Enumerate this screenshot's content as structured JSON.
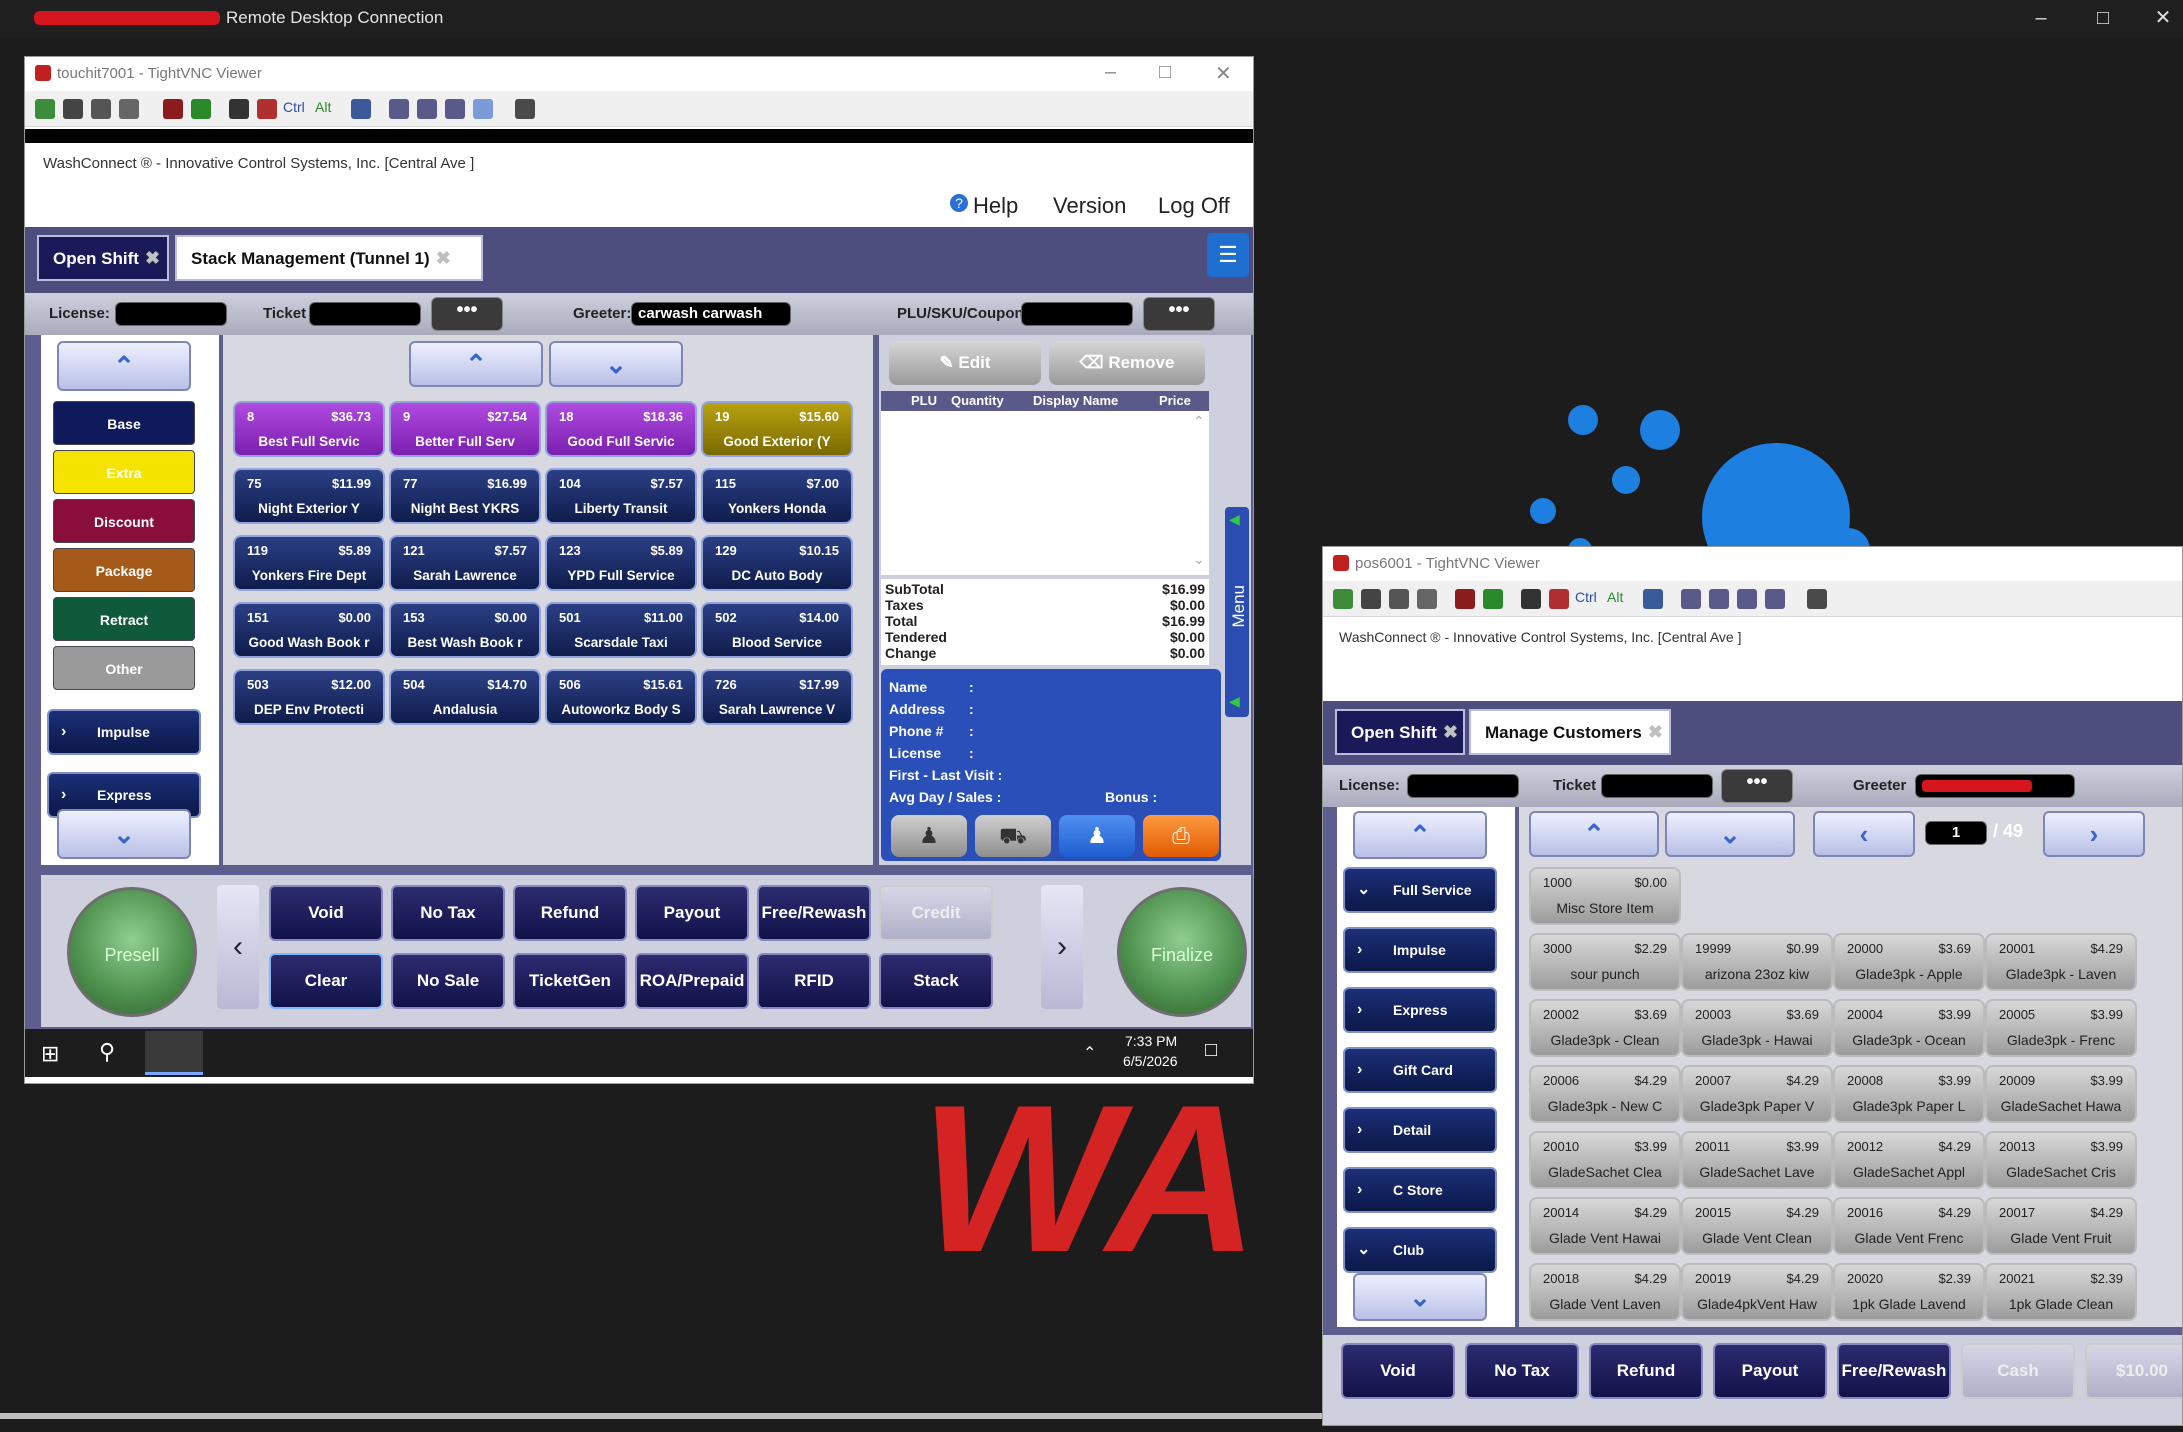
{
  "rdp": {
    "title": "Remote Desktop Connection"
  },
  "desktop": {
    "brand_text": "WA"
  },
  "vnc1": {
    "window_title": "touchit7001 - TightVNC Viewer",
    "app_title": "WashConnect ® - Innovative Control Systems, Inc. [Central Ave ]",
    "help": "Help",
    "version": "Version",
    "logoff": "Log Off",
    "tabs": [
      "Open Shift",
      "Stack Management (Tunnel 1)"
    ],
    "license_label": "License:",
    "ticket_label": "Ticket",
    "greeter_label": "Greeter:",
    "greeter_value": "carwash carwash",
    "plu_label": "PLU/SKU/Coupon",
    "categories": [
      "Base",
      "Extra",
      "Discount",
      "Package",
      "Retract",
      "Other",
      "Impulse",
      "Express"
    ],
    "products": [
      {
        "code": "8",
        "price": "$36.73",
        "name": "Best Full Servic",
        "color": "purple"
      },
      {
        "code": "9",
        "price": "$27.54",
        "name": "Better Full Serv",
        "color": "purple"
      },
      {
        "code": "18",
        "price": "$18.36",
        "name": "Good Full Servic",
        "color": "purple"
      },
      {
        "code": "19",
        "price": "$15.60",
        "name": "Good Exterior (Y",
        "color": "olive"
      },
      {
        "code": "75",
        "price": "$11.99",
        "name": "Night Exterior Y",
        "color": "blue"
      },
      {
        "code": "77",
        "price": "$16.99",
        "name": "Night Best YKRS",
        "color": "blue"
      },
      {
        "code": "104",
        "price": "$7.57",
        "name": "Liberty Transit",
        "color": "blue"
      },
      {
        "code": "115",
        "price": "$7.00",
        "name": "Yonkers Honda",
        "color": "blue"
      },
      {
        "code": "119",
        "price": "$5.89",
        "name": "Yonkers Fire Dept",
        "color": "blue"
      },
      {
        "code": "121",
        "price": "$7.57",
        "name": "Sarah Lawrence",
        "color": "blue"
      },
      {
        "code": "123",
        "price": "$5.89",
        "name": "YPD Full Service",
        "color": "blue"
      },
      {
        "code": "129",
        "price": "$10.15",
        "name": "DC Auto Body",
        "color": "blue"
      },
      {
        "code": "151",
        "price": "$0.00",
        "name": "Good Wash Book r",
        "color": "blue"
      },
      {
        "code": "153",
        "price": "$0.00",
        "name": "Best Wash Book r",
        "color": "blue"
      },
      {
        "code": "501",
        "price": "$11.00",
        "name": "Scarsdale Taxi",
        "color": "blue"
      },
      {
        "code": "502",
        "price": "$14.00",
        "name": "Blood Service",
        "color": "blue"
      },
      {
        "code": "503",
        "price": "$12.00",
        "name": "DEP Env Protecti",
        "color": "blue"
      },
      {
        "code": "504",
        "price": "$14.70",
        "name": "Andalusia",
        "color": "blue"
      },
      {
        "code": "506",
        "price": "$15.61",
        "name": "Autoworkz Body S",
        "color": "blue"
      },
      {
        "code": "726",
        "price": "$17.99",
        "name": "Sarah Lawrence V",
        "color": "blue"
      }
    ],
    "edit": "Edit",
    "remove": "Remove",
    "grid_headers": [
      "PLU",
      "Quantity",
      "Display Name",
      "Price"
    ],
    "totals": [
      {
        "label": "SubTotal",
        "value": "$16.99"
      },
      {
        "label": "Taxes",
        "value": "$0.00"
      },
      {
        "label": "Total",
        "value": "$16.99"
      },
      {
        "label": "Tendered",
        "value": "$0.00"
      },
      {
        "label": "Change",
        "value": "$0.00"
      }
    ],
    "customer": {
      "name": "Name",
      "address": "Address",
      "phone": "Phone #",
      "license": "License",
      "visit": "First - Last Visit :",
      "avg": "Avg Day / Sales :",
      "bonus": "Bonus :"
    },
    "menu_label": "Menu",
    "presell": "Presell",
    "finalize": "Finalize",
    "actions_top": [
      "Void",
      "No Tax",
      "Refund",
      "Payout",
      "Free/Rewash",
      "Credit"
    ],
    "actions_bottom": [
      "Clear",
      "No Sale",
      "TicketGen",
      "ROA/Prepaid",
      "RFID",
      "Stack"
    ],
    "clock_time": "7:33 PM",
    "clock_date": "6/5/2026"
  },
  "vnc2": {
    "window_title": "pos6001 - TightVNC Viewer",
    "app_title": "WashConnect ® - Innovative Control Systems, Inc. [Central Ave ]",
    "tabs": [
      "Open Shift",
      "Manage Customers"
    ],
    "license_label": "License:",
    "ticket_label": "Ticket",
    "greeter_label": "Greeter",
    "page_current": "1",
    "page_total": "/ 49",
    "categories": [
      "Full Service",
      "Impulse",
      "Express",
      "Gift Card",
      "Detail",
      "C Store",
      "Club"
    ],
    "first_product": {
      "code": "1000",
      "price": "$0.00",
      "name": "Misc Store Item"
    },
    "products": [
      {
        "code": "3000",
        "price": "$2.29",
        "name": "sour punch"
      },
      {
        "code": "19999",
        "price": "$0.99",
        "name": "arizona 23oz kiw"
      },
      {
        "code": "20000",
        "price": "$3.69",
        "name": "Glade3pk - Apple"
      },
      {
        "code": "20001",
        "price": "$4.29",
        "name": "Glade3pk - Laven"
      },
      {
        "code": "20002",
        "price": "$3.69",
        "name": "Glade3pk - Clean"
      },
      {
        "code": "20003",
        "price": "$3.69",
        "name": "Glade3pk - Hawai"
      },
      {
        "code": "20004",
        "price": "$3.99",
        "name": "Glade3pk - Ocean"
      },
      {
        "code": "20005",
        "price": "$3.99",
        "name": "Glade3pk - Frenc"
      },
      {
        "code": "20006",
        "price": "$4.29",
        "name": "Glade3pk - New C"
      },
      {
        "code": "20007",
        "price": "$4.29",
        "name": "Glade3pk Paper V"
      },
      {
        "code": "20008",
        "price": "$3.99",
        "name": "Glade3pk Paper L"
      },
      {
        "code": "20009",
        "price": "$3.99",
        "name": "GladeSachet Hawa"
      },
      {
        "code": "20010",
        "price": "$3.99",
        "name": "GladeSachet Clea"
      },
      {
        "code": "20011",
        "price": "$3.99",
        "name": "GladeSachet Lave"
      },
      {
        "code": "20012",
        "price": "$4.29",
        "name": "GladeSachet Appl"
      },
      {
        "code": "20013",
        "price": "$3.99",
        "name": "GladeSachet Cris"
      },
      {
        "code": "20014",
        "price": "$4.29",
        "name": "Glade Vent Hawai"
      },
      {
        "code": "20015",
        "price": "$4.29",
        "name": "Glade Vent Clean"
      },
      {
        "code": "20016",
        "price": "$4.29",
        "name": "Glade Vent Frenc"
      },
      {
        "code": "20017",
        "price": "$4.29",
        "name": "Glade Vent Fruit"
      },
      {
        "code": "20018",
        "price": "$4.29",
        "name": "Glade Vent Laven"
      },
      {
        "code": "20019",
        "price": "$4.29",
        "name": "Glade4pkVent Haw"
      },
      {
        "code": "20020",
        "price": "$2.39",
        "name": "1pk Glade Lavend"
      },
      {
        "code": "20021",
        "price": "$2.39",
        "name": "1pk Glade Clean"
      }
    ],
    "actions": [
      "Void",
      "No Tax",
      "Refund",
      "Payout",
      "Free/Rewash",
      "Cash",
      "$10.00"
    ]
  },
  "colors": {
    "purple": "#8a2fc0",
    "olive": "#8a7a00",
    "blue": "#1b2d6b",
    "accent_yellow": "#f5e400"
  }
}
